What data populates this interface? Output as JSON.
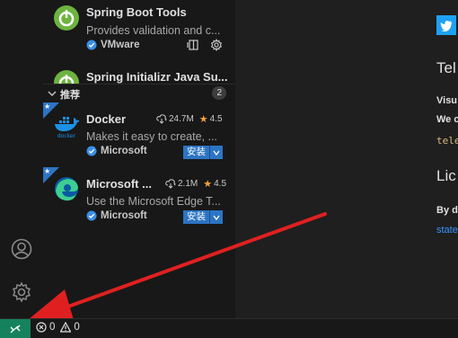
{
  "top_item": {
    "name": "Spring Boot Tools",
    "description": "Provides validation and c...",
    "publisher": "VMware"
  },
  "partial_item": {
    "name": "Spring Initializr Java Su..."
  },
  "recommended": {
    "title": "推荐",
    "count": "2"
  },
  "extensions": [
    {
      "name": "Docker",
      "description": "Makes it easy to create, ...",
      "publisher": "Microsoft",
      "downloads": "24.7M",
      "rating": "4.5",
      "install_label": "安装"
    },
    {
      "name": "Microsoft ...",
      "description": "Use the Microsoft Edge T...",
      "publisher": "Microsoft",
      "downloads": "2.1M",
      "rating": "4.5",
      "install_label": "安装"
    }
  ],
  "right_panel": {
    "heading1": "Tel",
    "line1": "Visu",
    "line2": "We c",
    "code": "tele",
    "heading2": "Lic",
    "line3": "By d",
    "link": "state"
  },
  "status": {
    "errors": "0",
    "warnings": "0"
  },
  "colors": {
    "accent": "#2c74c4",
    "remote": "#16825d",
    "arrow": "#e02020"
  }
}
